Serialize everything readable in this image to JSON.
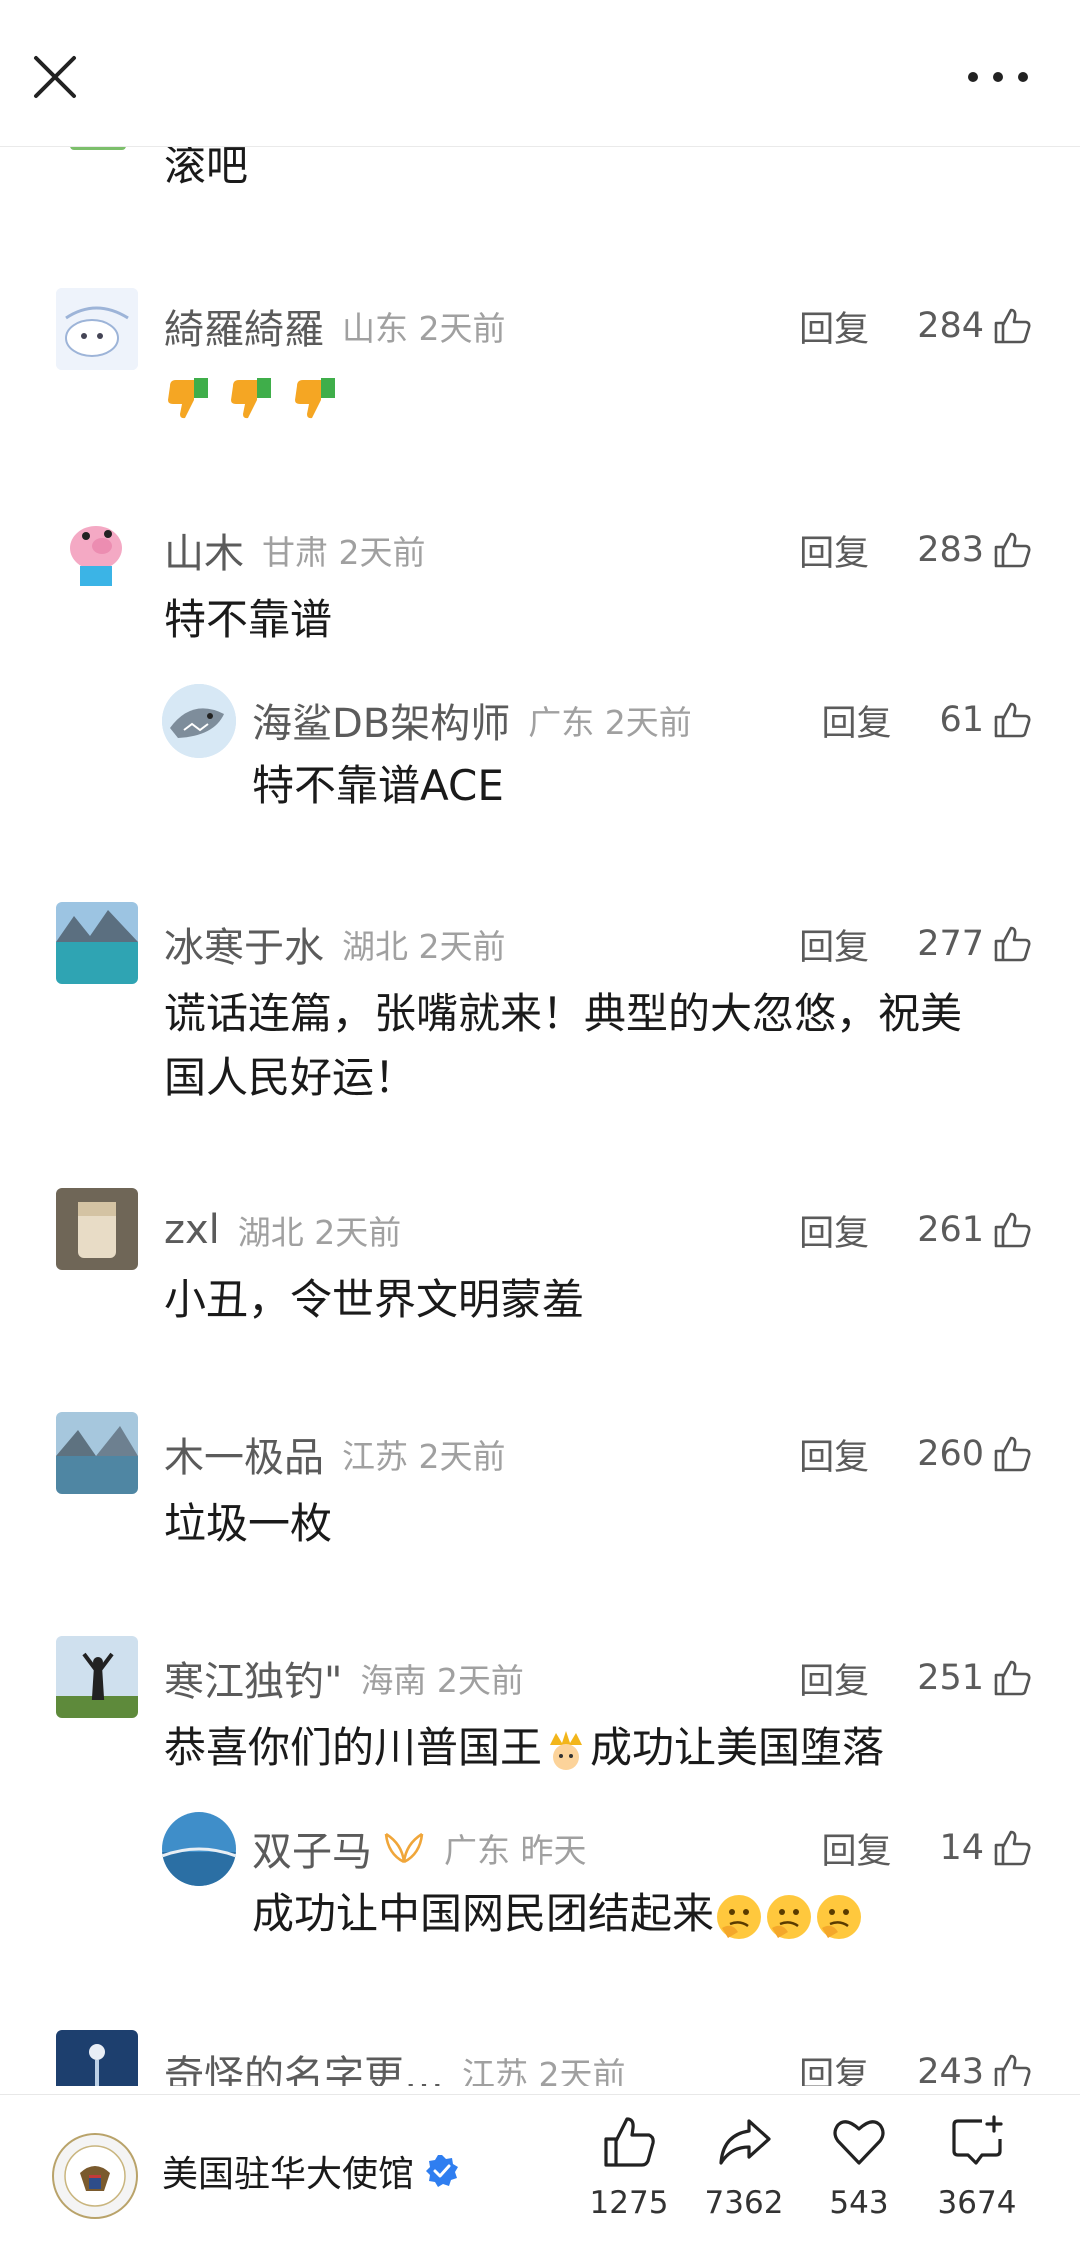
{
  "header": {
    "close_icon": "close-icon",
    "more_icon": "more-dots-icon"
  },
  "top_partial": {
    "text": "滚吧"
  },
  "comments": [
    {
      "user": "綺羅綺羅",
      "loc": "山东",
      "time": "2天前",
      "reply": "回复",
      "likes": "284",
      "text": ""
    },
    {
      "user": "山木",
      "loc": "甘肃",
      "time": "2天前",
      "reply": "回复",
      "likes": "283",
      "text": "特不靠谱"
    },
    {
      "user": "冰寒于水",
      "loc": "湖北",
      "time": "2天前",
      "reply": "回复",
      "likes": "277",
      "text1": "谎话连篇，张嘴就来！典型的大忽悠，祝美",
      "text2": "国人民好运！"
    },
    {
      "user": "zxl",
      "loc": "湖北",
      "time": "2天前",
      "reply": "回复",
      "likes": "261",
      "text": "小丑，令世界文明蒙羞"
    },
    {
      "user": "木一极品",
      "loc": "江苏",
      "time": "2天前",
      "reply": "回复",
      "likes": "260",
      "text": "垃圾一枚"
    },
    {
      "user": "寒江独钓\"",
      "loc": "海南",
      "time": "2天前",
      "reply": "回复",
      "likes": "251",
      "text_a": "恭喜你们的川普国王",
      "text_b": "成功让美国堕落"
    },
    {
      "user": "奇怪的名字更…",
      "loc": "江苏",
      "time": "2天前",
      "reply": "回复",
      "likes": "243"
    }
  ],
  "replies": [
    {
      "user": "海鲨DB架构师",
      "loc": "广东",
      "time": "2天前",
      "reply": "回复",
      "likes": "61",
      "text": "特不靠谱ACE"
    },
    {
      "user": "双子马",
      "loc": "广东",
      "time": "昨天",
      "reply": "回复",
      "likes": "14",
      "text": "成功让中国网民团结起来"
    }
  ],
  "bottom": {
    "account": "美国驻华大使馆",
    "likes": "1275",
    "shares": "7362",
    "favorites": "543",
    "comments": "3674"
  },
  "colors": {
    "meta_gray": "#a0a0a0",
    "name_gray": "#5b5b5b",
    "verified_blue": "#2f7ef0"
  }
}
